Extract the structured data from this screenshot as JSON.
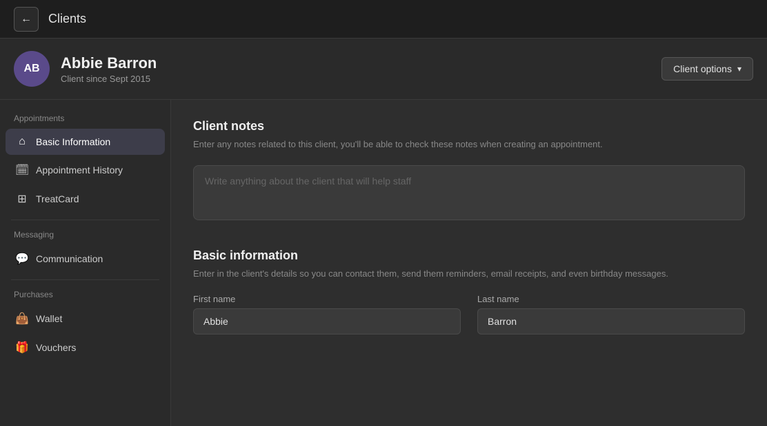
{
  "topbar": {
    "title": "Clients",
    "back_label": "←"
  },
  "client": {
    "initials": "AB",
    "name": "Abbie Barron",
    "since": "Client since Sept 2015",
    "options_button": "Client options"
  },
  "sidebar": {
    "section_appointments": "Appointments",
    "section_messaging": "Messaging",
    "section_purchases": "Purchases",
    "items": [
      {
        "id": "basic-information",
        "label": "Basic Information",
        "icon": "🏠",
        "active": true
      },
      {
        "id": "appointment-history",
        "label": "Appointment History",
        "icon": "🗓",
        "active": false
      },
      {
        "id": "treatcard",
        "label": "TreatCard",
        "icon": "⊞",
        "active": false
      },
      {
        "id": "communication",
        "label": "Communication",
        "icon": "💬",
        "active": false
      },
      {
        "id": "wallet",
        "label": "Wallet",
        "icon": "👜",
        "active": false
      },
      {
        "id": "vouchers",
        "label": "Vouchers",
        "icon": "🎁",
        "active": false
      }
    ]
  },
  "content": {
    "notes_title": "Client notes",
    "notes_desc": "Enter any notes related to this client, you'll be able to check these notes when creating an appointment.",
    "notes_placeholder": "Write anything about the client that will help staff",
    "basic_info_title": "Basic information",
    "basic_info_desc": "Enter in the client's details so you can contact them, send them reminders, email receipts, and even birthday messages.",
    "first_name_label": "First name",
    "first_name_value": "Abbie",
    "last_name_label": "Last name",
    "last_name_value": "Barron"
  }
}
